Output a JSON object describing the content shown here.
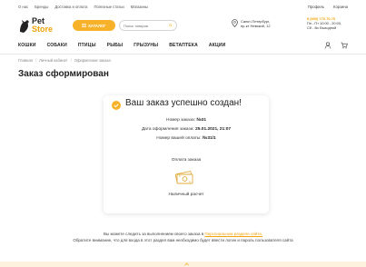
{
  "topbar": {
    "links": [
      "О нас",
      "Бренды",
      "Доставка и оплата",
      "Полезные статьи",
      "Магазины"
    ],
    "profile": "Профиль",
    "cart": "Корзина"
  },
  "header": {
    "logo_line1": "Pet",
    "logo_line2": "Store",
    "catalog_label": "КАТАЛОГ",
    "search_placeholder": "Поиск товаров",
    "address_line1": "Санкт-Петербург,",
    "address_line2": "пр-кт Невский, 12",
    "phone": "8 (800) 770-70-70",
    "hours_line1": "Пн - Пт 10:00 - 20:00,",
    "hours_line2": "Сб - Вс Выходной"
  },
  "nav": {
    "items": [
      "КОШКИ",
      "СОБАКИ",
      "ПТИЦЫ",
      "РЫБЫ",
      "ГРЫЗУНЫ",
      "ВЕТАПТЕКА",
      "АКЦИИ"
    ]
  },
  "breadcrumb": {
    "items": [
      "Главная",
      "Личный кабинет",
      "Оформление заказа"
    ],
    "separator": "/"
  },
  "page": {
    "title": "Заказ сформирован"
  },
  "order": {
    "success_text": "Ваш заказ успешно создан!",
    "number_label": "Номер заказа:",
    "number_value": "№31",
    "date_label": "Дата оформления заказа:",
    "date_value": "25.01.2021, 21:07",
    "payment_label": "Номер вашей оплаты:",
    "payment_value": "№31/1",
    "pay_section_label": "Оплата заказа",
    "pay_type": "Наличный расчет"
  },
  "note": {
    "line1_before": "Вы можете следить за выполнением своего заказа в",
    "line1_link": "Персональном разделе сайта.",
    "line2": "Обратите внимание, что для входа в этот раздел вам необходимо будет ввести логин и пароль пользователя сайта"
  },
  "colors": {
    "accent": "#f7b22a",
    "accent_dark": "#f0a30a",
    "cash_green": "#e8b84a"
  }
}
